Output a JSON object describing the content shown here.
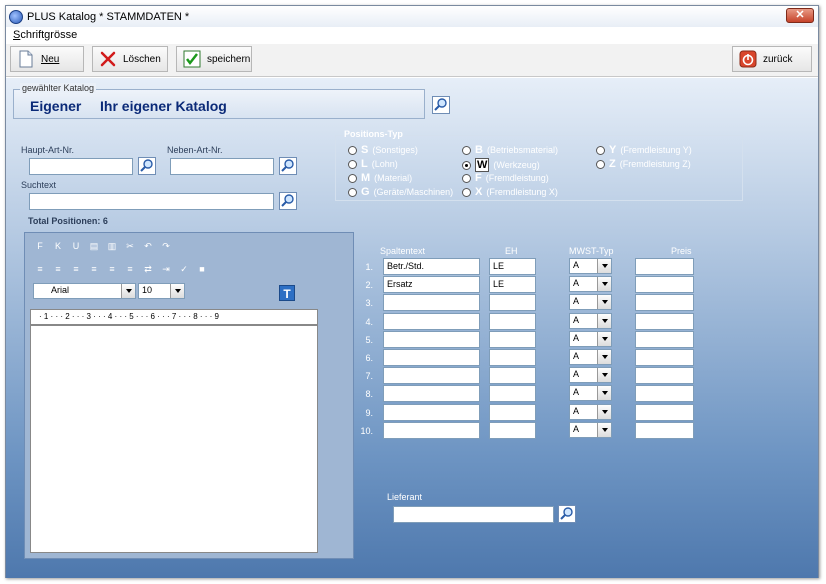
{
  "window": {
    "title": "PLUS Katalog   * STAMMDATEN *",
    "close_label": "✕"
  },
  "menu": {
    "item": "Schriftgrösse"
  },
  "toolbar": {
    "new_label": "Neu",
    "delete_label": "Löschen",
    "save_label": "speichern",
    "back_label": "zurück"
  },
  "catalog": {
    "legend": "gewählter Katalog",
    "code": "Eigener",
    "name": "Ihr eigener Katalog"
  },
  "fields": {
    "haupt_label": "Haupt-Art-Nr.",
    "haupt_value": "",
    "neben_label": "Neben-Art-Nr.",
    "neben_value": "",
    "such_label": "Suchtext",
    "such_value": "",
    "total": "Total Positionen: 6"
  },
  "positions": {
    "legend": "Positions-Typ",
    "types": [
      {
        "letter": "S",
        "desc": "(Sonstiges)",
        "checked": false
      },
      {
        "letter": "L",
        "desc": "(Lohn)",
        "checked": false
      },
      {
        "letter": "M",
        "desc": "(Material)",
        "checked": false
      },
      {
        "letter": "G",
        "desc": "(Geräte/Maschinen)",
        "checked": false
      },
      {
        "letter": "B",
        "desc": "(Betriebsmaterial)",
        "checked": false
      },
      {
        "letter": "W",
        "desc": "(Werkzeug)",
        "checked": true
      },
      {
        "letter": "F",
        "desc": "(Fremdleistung)",
        "checked": false
      },
      {
        "letter": "X",
        "desc": "(Fremdleistung X)",
        "checked": false
      },
      {
        "letter": "Y",
        "desc": "(Fremdleistung Y)",
        "checked": false
      },
      {
        "letter": "Z",
        "desc": "(Fremdleistung Z)",
        "checked": false
      }
    ]
  },
  "editor": {
    "font": "Arial",
    "size": "10",
    "ruler": "· 1 · · · 2 · · · 3 · · · 4 · · · 5 · · · 6 · · · 7 · · · 8 · · · 9"
  },
  "table": {
    "headers": [
      "Spaltentext",
      "EH",
      "MWST-Typ",
      "Preis"
    ],
    "rows": [
      {
        "num": "1.",
        "text": "Betr./Std.",
        "eh": "LE",
        "mwst": "A",
        "preis": ""
      },
      {
        "num": "2.",
        "text": "Ersatz",
        "eh": "LE",
        "mwst": "A",
        "preis": ""
      },
      {
        "num": "3.",
        "text": "",
        "eh": "",
        "mwst": "A",
        "preis": ""
      },
      {
        "num": "4.",
        "text": "",
        "eh": "",
        "mwst": "A",
        "preis": ""
      },
      {
        "num": "5.",
        "text": "",
        "eh": "",
        "mwst": "A",
        "preis": ""
      },
      {
        "num": "6.",
        "text": "",
        "eh": "",
        "mwst": "A",
        "preis": ""
      },
      {
        "num": "7.",
        "text": "",
        "eh": "",
        "mwst": "A",
        "preis": ""
      },
      {
        "num": "8.",
        "text": "",
        "eh": "",
        "mwst": "A",
        "preis": ""
      },
      {
        "num": "9.",
        "text": "",
        "eh": "",
        "mwst": "A",
        "preis": ""
      },
      {
        "num": "10.",
        "text": "",
        "eh": "",
        "mwst": "A",
        "preis": ""
      }
    ]
  },
  "lieferant": {
    "label": "Lieferant",
    "value": ""
  }
}
